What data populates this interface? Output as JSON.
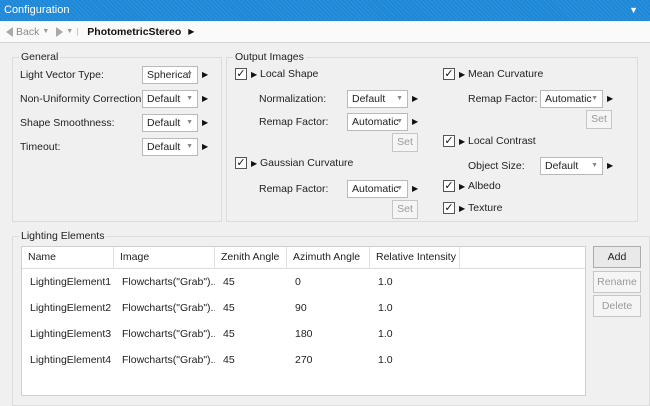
{
  "window": {
    "title": "Configuration"
  },
  "nav": {
    "back_label": "Back",
    "breadcrumb": "PhotometricStereo"
  },
  "general": {
    "title": "General",
    "light_vector_type": {
      "label": "Light Vector Type:",
      "value": "Spherical"
    },
    "non_uniformity": {
      "label": "Non-Uniformity Correction:",
      "value": "Default"
    },
    "shape_smoothness": {
      "label": "Shape Smoothness:",
      "value": "Default"
    },
    "timeout": {
      "label": "Timeout:",
      "value": "Default"
    }
  },
  "output": {
    "title": "Output Images",
    "local_shape": {
      "label": "Local Shape",
      "checked": true,
      "normalization": {
        "label": "Normalization:",
        "value": "Default"
      },
      "remap_factor": {
        "label": "Remap Factor:",
        "value": "Automatic"
      },
      "set_label": "Set"
    },
    "gaussian_curvature": {
      "label": "Gaussian Curvature",
      "checked": true,
      "remap_factor": {
        "label": "Remap Factor:",
        "value": "Automatic"
      },
      "set_label": "Set"
    },
    "mean_curvature": {
      "label": "Mean Curvature",
      "checked": true,
      "remap_factor": {
        "label": "Remap Factor:",
        "value": "Automatic"
      },
      "set_label": "Set"
    },
    "local_contrast": {
      "label": "Local Contrast",
      "checked": true,
      "object_size": {
        "label": "Object Size:",
        "value": "Default"
      }
    },
    "albedo": {
      "label": "Albedo",
      "checked": true
    },
    "texture": {
      "label": "Texture",
      "checked": true
    }
  },
  "lighting": {
    "title": "Lighting Elements",
    "columns": [
      "Name",
      "Image",
      "Zenith Angle",
      "Azimuth Angle",
      "Relative Intensity"
    ],
    "rows": [
      [
        "LightingElement1",
        "Flowcharts(\"Grab\")....",
        "45",
        "0",
        "1.0"
      ],
      [
        "LightingElement2",
        "Flowcharts(\"Grab\")....",
        "45",
        "90",
        "1.0"
      ],
      [
        "LightingElement3",
        "Flowcharts(\"Grab\")....",
        "45",
        "180",
        "1.0"
      ],
      [
        "LightingElement4",
        "Flowcharts(\"Grab\")....",
        "45",
        "270",
        "1.0"
      ]
    ],
    "buttons": {
      "add": "Add",
      "rename": "Rename",
      "delete": "Delete"
    }
  },
  "icons": {
    "back": "back-arrow-icon",
    "forward": "forward-arrow-icon",
    "expander": "expander-arrow-icon",
    "dropdown": "chevron-down-icon"
  },
  "colors": {
    "titlebar": "#1e88d8",
    "background": "#f0f0f0"
  }
}
